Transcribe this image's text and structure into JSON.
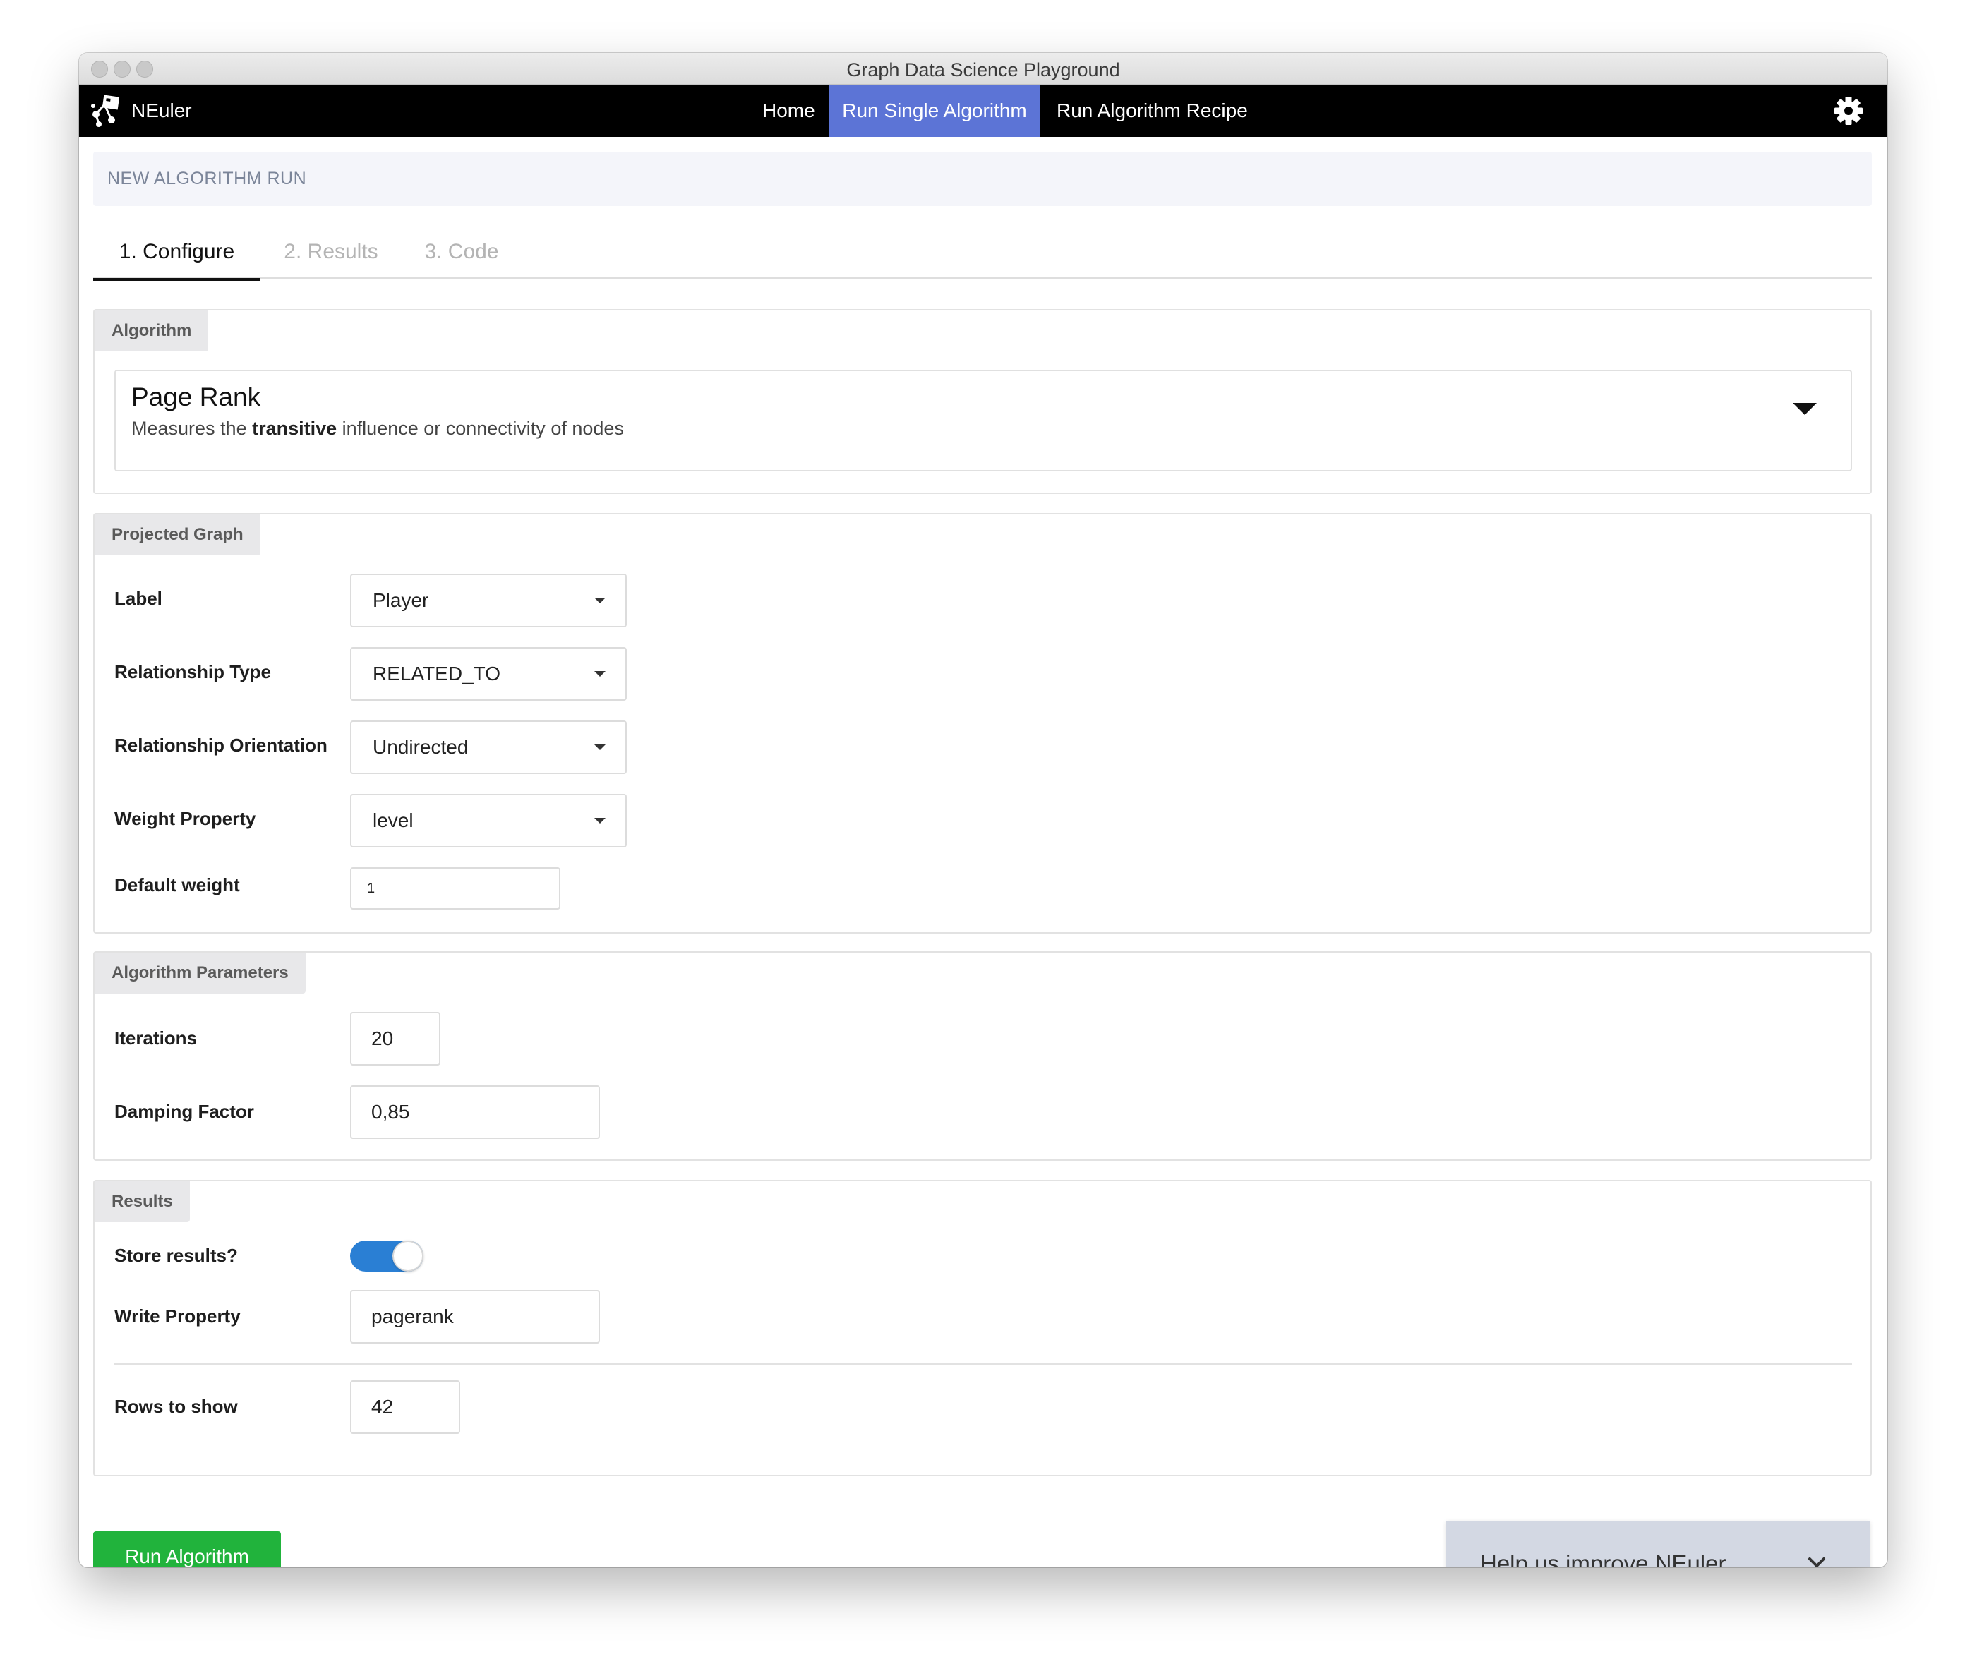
{
  "window": {
    "title": "Graph Data Science Playground"
  },
  "navbar": {
    "brand": "NEuler",
    "items": [
      {
        "label": "Home"
      },
      {
        "label": "Run Single Algorithm"
      },
      {
        "label": "Run Algorithm Recipe"
      }
    ],
    "settings_icon": "gear-icon",
    "active_color": "#5c74d6"
  },
  "page": {
    "header": "NEW ALGORITHM RUN"
  },
  "tabs": [
    {
      "label": "1. Configure"
    },
    {
      "label": "2. Results"
    },
    {
      "label": "3. Code"
    }
  ],
  "algorithm_panel": {
    "tag": "Algorithm",
    "name": "Page Rank",
    "desc_before": "Measures the ",
    "desc_bold": "transitive",
    "desc_after": " influence or connectivity of nodes"
  },
  "projected_graph": {
    "tag": "Projected Graph",
    "label_label": "Label",
    "label_value": "Player",
    "rel_type_label": "Relationship Type",
    "rel_type_value": "RELATED_TO",
    "orientation_label": "Relationship Orientation",
    "orientation_value": "Undirected",
    "weight_label": "Weight Property",
    "weight_value": "level",
    "default_weight_label": "Default weight",
    "default_weight_value": "1"
  },
  "algorithm_params": {
    "tag": "Algorithm Parameters",
    "iterations_label": "Iterations",
    "iterations_value": "20",
    "damping_label": "Damping Factor",
    "damping_value": "0,85"
  },
  "results": {
    "tag": "Results",
    "store_label": "Store results?",
    "store_enabled": true,
    "toggle_color": "#2a7fd4",
    "write_label": "Write Property",
    "write_value": "pagerank",
    "rows_label": "Rows to show",
    "rows_value": "42"
  },
  "actions": {
    "run_label": "Run Algorithm",
    "run_color": "#21b33c"
  },
  "feedback": {
    "label": "Help us improve NEuler"
  }
}
